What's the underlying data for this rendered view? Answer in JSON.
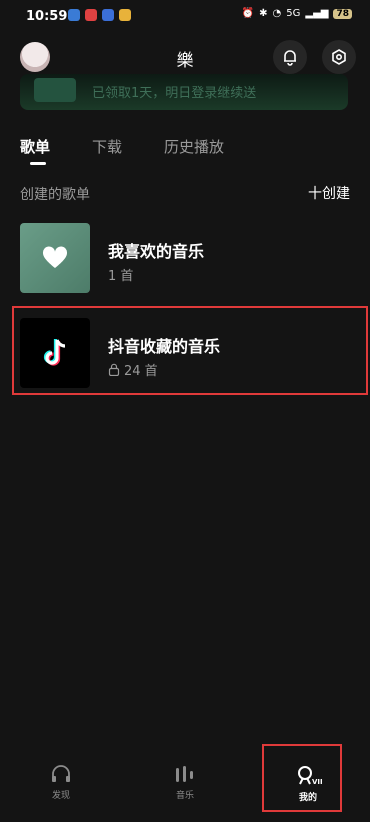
{
  "status_bar": {
    "time": "10:59",
    "network": "5G",
    "battery": "78"
  },
  "header": {
    "title": "樂"
  },
  "banner": {
    "text": "已领取1天，明日登录继续送"
  },
  "tabs": [
    {
      "label": "歌单",
      "active": true
    },
    {
      "label": "下载",
      "active": false
    },
    {
      "label": "历史播放",
      "active": false
    }
  ],
  "section": {
    "label": "创建的歌单",
    "create_label": "十创建"
  },
  "playlists": [
    {
      "name": "我喜欢的音乐",
      "count": "1 首",
      "cover_color": "#5b8c78"
    },
    {
      "name": "抖音收藏的音乐",
      "count": "24 首",
      "locked": true,
      "cover_color": "#000000"
    }
  ],
  "bottom_nav": [
    {
      "label": "发现",
      "active": false
    },
    {
      "label": "音乐",
      "active": false
    },
    {
      "label": "我的",
      "active": true,
      "badge": "VIP"
    }
  ],
  "colors": {
    "background": "#141414",
    "highlight": "#e03a3a"
  }
}
